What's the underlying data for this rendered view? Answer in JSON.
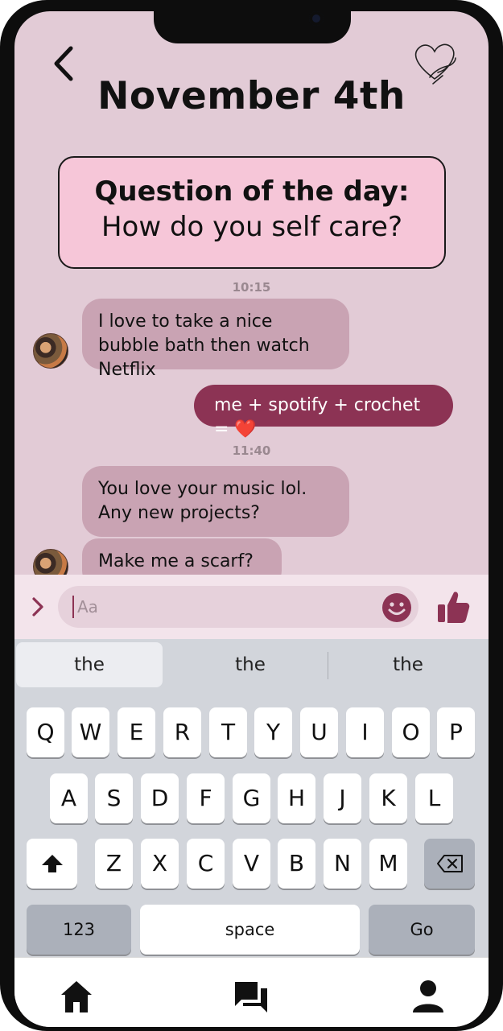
{
  "header": {
    "title": "November 4th",
    "back_icon": "chevron-left-icon",
    "favorite_icon": "heart-hand-icon"
  },
  "question": {
    "label": "Question of the day:",
    "text": "How do you self care?"
  },
  "messages": [
    {
      "time": "10:15",
      "sender": "friend",
      "text": "I love to take a nice bubble bath then watch Netflix"
    },
    {
      "sender": "me",
      "text": "me + spotify + crochet = ❤️"
    },
    {
      "time": "11:40",
      "sender": "friend",
      "text": "You love your music lol. Any new projects?"
    },
    {
      "sender": "friend",
      "text": "Make me a scarf? ☺️"
    }
  ],
  "composer": {
    "placeholder": "Aa",
    "expand_icon": "chevron-right-icon",
    "emoji_icon": "smiley-icon",
    "send_icon": "thumbs-up-icon"
  },
  "keyboard": {
    "suggestions": [
      "the",
      "the",
      "the"
    ],
    "rows": [
      [
        "Q",
        "W",
        "E",
        "R",
        "T",
        "Y",
        "U",
        "I",
        "O",
        "P"
      ],
      [
        "A",
        "S",
        "D",
        "F",
        "G",
        "H",
        "J",
        "K",
        "L"
      ],
      [
        "Z",
        "X",
        "C",
        "V",
        "B",
        "N",
        "M"
      ]
    ],
    "numbers_label": "123",
    "space_label": "space",
    "go_label": "Go",
    "shift_icon": "shift-icon",
    "backspace_icon": "backspace-icon"
  },
  "bottom_nav": [
    {
      "name": "home",
      "icon": "home-icon"
    },
    {
      "name": "messages",
      "icon": "chat-icon"
    },
    {
      "name": "profile",
      "icon": "person-icon"
    }
  ],
  "colors": {
    "background": "#e2cbd6",
    "accent": "#8c3354",
    "incoming_bubble": "#c9a3b3",
    "question_box": "#f6c6d8"
  }
}
